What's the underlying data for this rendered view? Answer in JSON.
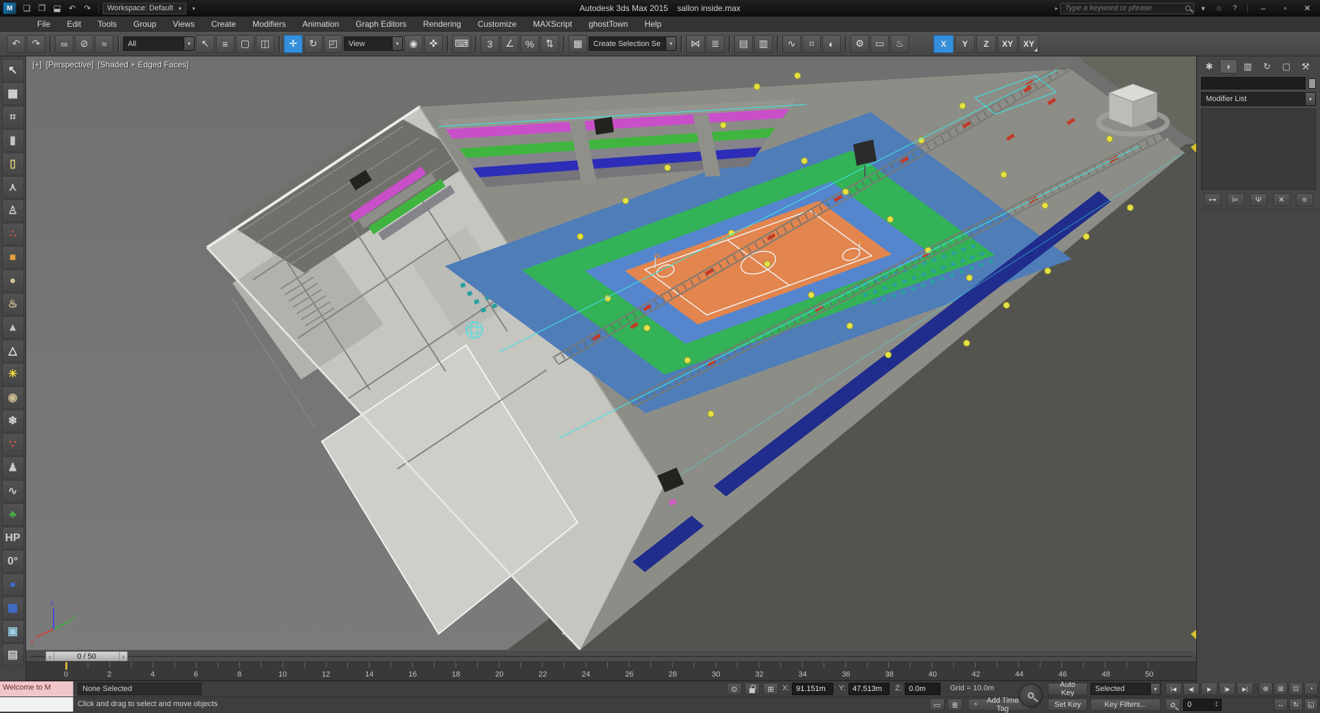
{
  "colors": {
    "selection_blue": "#3590dc",
    "arena_blue": "#4e7db8",
    "court_blue": "#5585cd",
    "court_orange": "#e2854e",
    "floor_green": "#33b257",
    "stands_magenta": "#c94fc9",
    "stands_green": "#3fb43f",
    "stands_blue": "#2d2db8",
    "lights_yellow": "#e4e243",
    "clamp_red": "#c23b27",
    "wire_cyan": "#3fe3e3",
    "navy_band": "#202d8c",
    "seat_teal": "#2aa0a0"
  },
  "icons": {
    "chevron": "▾",
    "search_arrow": "▸",
    "spinner_up": "▴",
    "spinner_down": "▾",
    "isolate": "⊙",
    "abs_mode": "⊞",
    "macro_recorder": "▭",
    "listener_window": "≣",
    "time_tag": "◔"
  },
  "titlebar": {
    "app_icon": "M",
    "qat": {
      "new": "❏",
      "open": "❒",
      "save": "⬓",
      "undo": "↶",
      "redo": "↷"
    },
    "workspace": "Workspace: Default",
    "title": "Autodesk 3ds Max 2015    sallon inside.max",
    "search_placeholder": "Type a keyword or phrase",
    "infocenter": {
      "signin": "▾",
      "favorites": "☆",
      "help": "?"
    },
    "window": {
      "minimize": "–",
      "maximize": "▫",
      "close": "✕"
    }
  },
  "menubar": {
    "items": [
      "File",
      "Edit",
      "Tools",
      "Group",
      "Views",
      "Create",
      "Modifiers",
      "Animation",
      "Graph Editors",
      "Rendering",
      "Customize",
      "MAXScript",
      "ghostTown",
      "Help"
    ]
  },
  "toolbar": {
    "glyphs": {
      "undo": "↶",
      "redo": "↷",
      "link": "∞",
      "unlink": "⊘",
      "bind": "≈",
      "select": "↖",
      "select_by_name": "≡",
      "region": "▢",
      "crossing": "◫",
      "move": "✛",
      "rotate": "↻",
      "scale": "◰",
      "center": "◉",
      "manipulate": "✜",
      "keyboard": "⌨",
      "snap3": "3",
      "angle": "∠",
      "percent": "%",
      "spinner": "⇅",
      "sel_sets": "▦",
      "mirror": "⋈",
      "align": "≣",
      "scene_explorer": "▤",
      "layer_explorer": "▥",
      "curve_editor": "∿",
      "schematic": "⌗",
      "material": "◐",
      "render_setup": "⚙",
      "rfw": "▭",
      "render": "♨"
    },
    "selection_filter": "All",
    "coord_system": "View",
    "selection_set": "Create Selection Se",
    "axis": [
      "X",
      "Y",
      "Z",
      "XY",
      "XY"
    ]
  },
  "left_toolbar": {
    "items": [
      {
        "name": "select-object-icon",
        "glyph": "↖",
        "color": "#e3e3e3"
      },
      {
        "name": "grid-plane-icon",
        "glyph": "▦",
        "color": "#dcdcdc"
      },
      {
        "name": "autogrid-icon",
        "glyph": "⌗",
        "color": "#c9c9c9"
      },
      {
        "name": "cylinder-icon",
        "glyph": "▮",
        "color": "#c4c4c4"
      },
      {
        "name": "tube-light-icon",
        "glyph": "▯",
        "color": "#ded37a"
      },
      {
        "name": "bones-icon",
        "glyph": "⋏",
        "color": "#c9c9c9"
      },
      {
        "name": "biped-icon",
        "glyph": "♙",
        "color": "#c9c9c9"
      },
      {
        "name": "particle-array-icon",
        "glyph": "∴",
        "color": "#d85a46"
      },
      {
        "name": "box-icon",
        "glyph": "■",
        "color": "#e0a23c"
      },
      {
        "name": "sphere-icon",
        "glyph": "●",
        "color": "#d6c49c"
      },
      {
        "name": "teapot-icon",
        "glyph": "♨",
        "color": "#d6c49c"
      },
      {
        "name": "cone-icon",
        "glyph": "▲",
        "color": "#c4c4c4"
      },
      {
        "name": "pyramid-icon",
        "glyph": "△",
        "color": "#eaeaea"
      },
      {
        "name": "sun-light-icon",
        "glyph": "☀",
        "color": "#f0da3e"
      },
      {
        "name": "geosphere-icon",
        "glyph": "◉",
        "color": "#cdbb92"
      },
      {
        "name": "snowflake-icon",
        "glyph": "❄",
        "color": "#d8d8d8"
      },
      {
        "name": "spray-icon",
        "glyph": "∵",
        "color": "#d85a46"
      },
      {
        "name": "character-icon",
        "glyph": "♟",
        "color": "#c9c9c9"
      },
      {
        "name": "helix-icon",
        "glyph": "∿",
        "color": "#c9c9c9"
      },
      {
        "name": "foliage-icon",
        "glyph": "♣",
        "color": "#4aae4a"
      },
      {
        "name": "hp-tool-icon",
        "glyph": "HP",
        "color": "#cfcfcf"
      },
      {
        "name": "degree-tool-icon",
        "glyph": "0°",
        "color": "#cfcfcf"
      },
      {
        "name": "blue-sphere-icon",
        "glyph": "●",
        "color": "#3e6fd0"
      },
      {
        "name": "blue-grid-icon",
        "glyph": "▦",
        "color": "#3e6fd0"
      },
      {
        "name": "display-icon",
        "glyph": "▣",
        "color": "#9ad0e8"
      },
      {
        "name": "plane-icon",
        "glyph": "▤",
        "color": "#cfcfcf"
      }
    ]
  },
  "viewport": {
    "label_plus": "[+]",
    "label_view": "[Perspective]",
    "label_shading": "[Shaded + Edged Faces]"
  },
  "command_panel": {
    "tabs": [
      {
        "name": "create-tab-icon",
        "glyph": "✱"
      },
      {
        "name": "modify-tab-icon",
        "glyph": "◗"
      },
      {
        "name": "hierarchy-tab-icon",
        "glyph": "▥"
      },
      {
        "name": "motion-tab-icon",
        "glyph": "↻"
      },
      {
        "name": "display-tab-icon",
        "glyph": "▢"
      },
      {
        "name": "utilities-tab-icon",
        "glyph": "⚒"
      }
    ],
    "object_name_value": "",
    "modifier_list": "Modifier List",
    "stack_buttons": [
      {
        "name": "pin-stack-icon",
        "glyph": "⊶"
      },
      {
        "name": "show-end-result-icon",
        "glyph": "⊨"
      },
      {
        "name": "make-unique-icon",
        "glyph": "Ψ"
      },
      {
        "name": "remove-modifier-icon",
        "glyph": "✕"
      },
      {
        "name": "configure-modifier-sets-icon",
        "glyph": "≡"
      }
    ]
  },
  "timeline": {
    "frame_indicator": "0 / 50",
    "nub_left": "‹",
    "nub_right": "›",
    "labels": [
      "0",
      "2",
      "4",
      "6",
      "8",
      "10",
      "12",
      "14",
      "16",
      "18",
      "20",
      "22",
      "24",
      "26",
      "28",
      "30",
      "32",
      "34",
      "36",
      "38",
      "40",
      "42",
      "44",
      "46",
      "48",
      "50"
    ]
  },
  "statusbar": {
    "listener_text": "Welcome to M",
    "selection_status": "None Selected",
    "prompt": "Click and drag to select and move objects",
    "coord_x_label": "X:",
    "coord_x": "91.151m",
    "coord_y_label": "Y:",
    "coord_y": "47.513m",
    "coord_z_label": "Z:",
    "coord_z": "0.0m",
    "grid": "Grid = 10.0m",
    "add_time_tag": "Add Time Tag",
    "auto_key": "Auto Key",
    "set_key": "Set Key",
    "key_mode_dropdown": "Selected",
    "key_filters": "Key Filters...",
    "frame_field": "0",
    "playback": [
      {
        "name": "go-to-start-button",
        "glyph": "|◀"
      },
      {
        "name": "previous-frame-button",
        "glyph": "◀|"
      },
      {
        "name": "play-button",
        "glyph": "▶"
      },
      {
        "name": "next-frame-button",
        "glyph": "|▶"
      },
      {
        "name": "go-to-end-button",
        "glyph": "▶|"
      }
    ],
    "vpnav_row1": [
      {
        "name": "zoom-button",
        "glyph": "⊕"
      },
      {
        "name": "zoom-all-button",
        "glyph": "⊞"
      },
      {
        "name": "zoom-extents-button",
        "glyph": "⊡"
      },
      {
        "name": "fov-button",
        "glyph": "◔"
      }
    ],
    "vpnav_row2": [
      {
        "name": "pan-button",
        "glyph": "↔"
      },
      {
        "name": "orbit-button",
        "glyph": "↻"
      },
      {
        "name": "maximize-viewport-button",
        "glyph": "◱"
      }
    ]
  }
}
